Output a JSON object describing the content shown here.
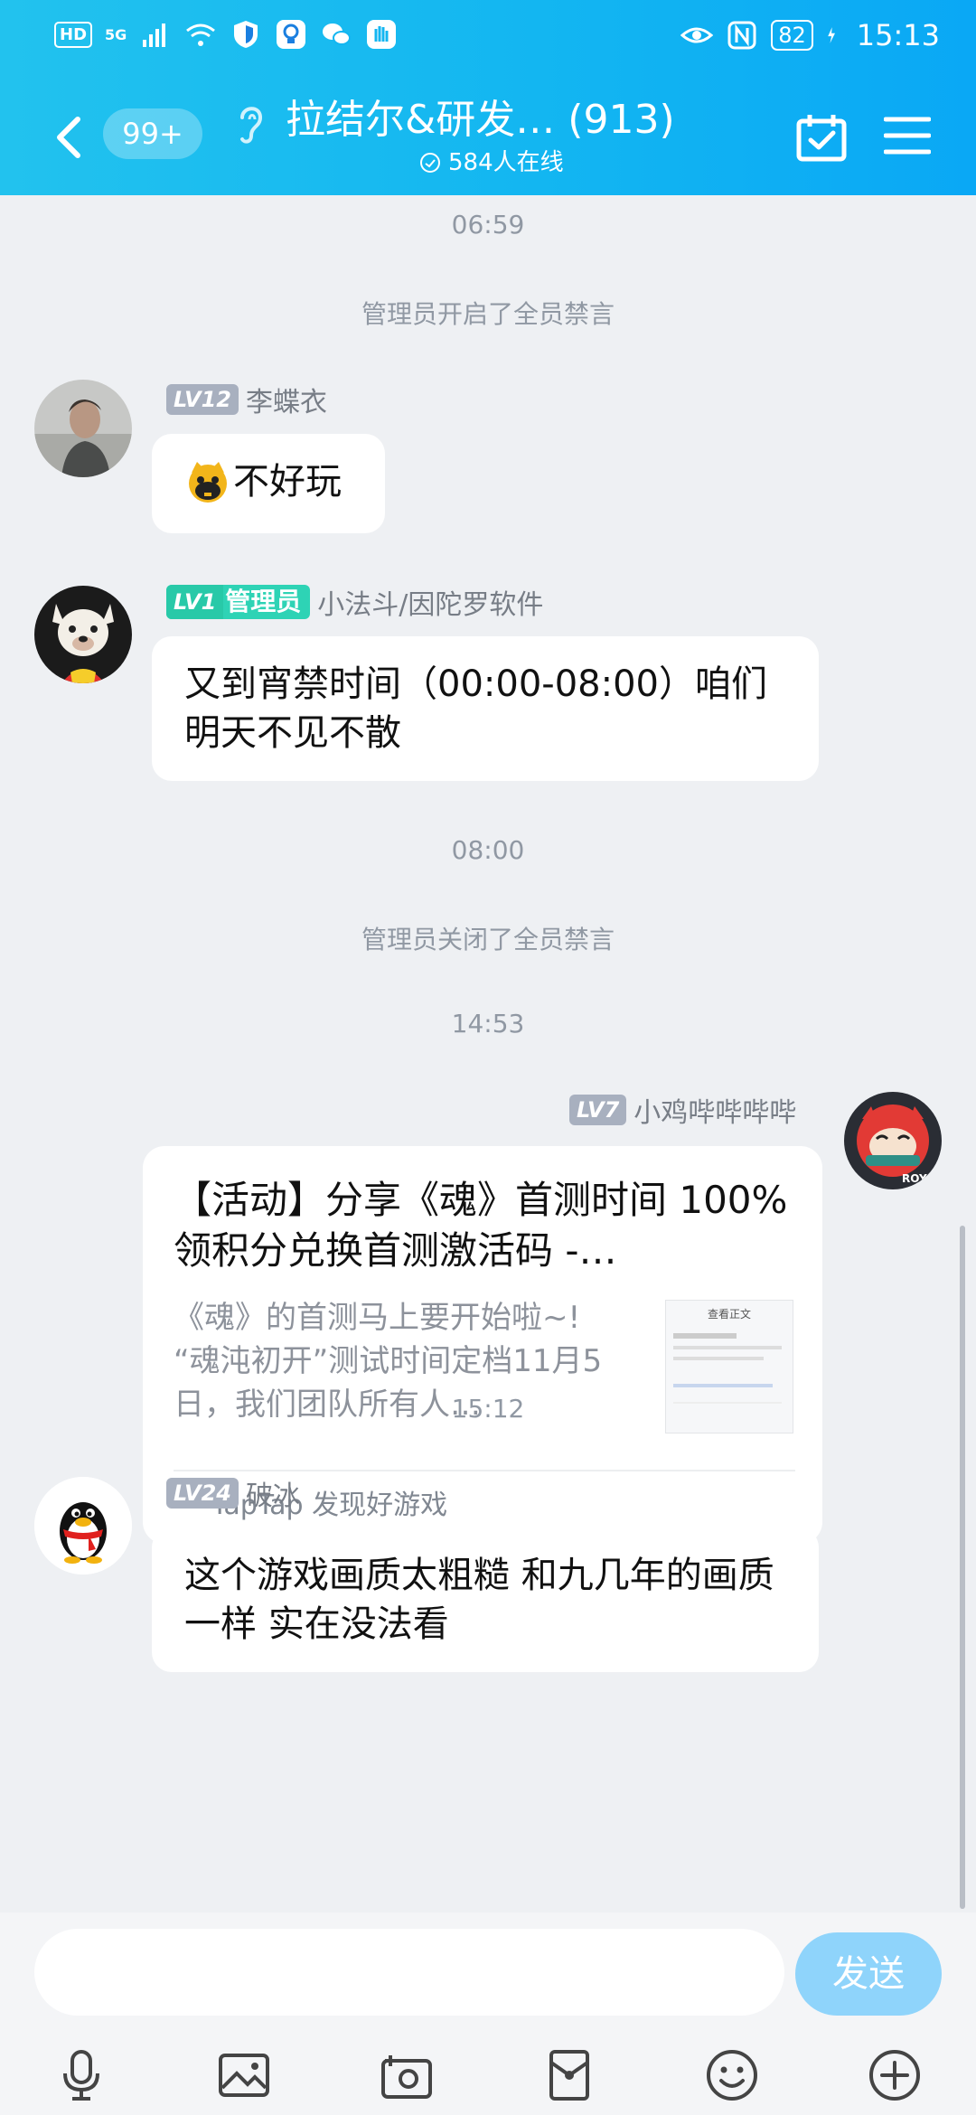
{
  "status_bar": {
    "hd": "HD",
    "network": "5G",
    "battery": "82",
    "time": "15:13"
  },
  "nav": {
    "unread_count": "99+",
    "title": "拉结尔&研发…  (913)",
    "online": "584人在线"
  },
  "messages": {
    "time_1": "06:59",
    "notice_1": "管理员开启了全员禁言",
    "msg1_lv": "LV12",
    "msg1_name": "李蝶衣",
    "msg1_text": "不好玩",
    "msg2_lv": "LV1",
    "msg2_role": "管理员",
    "msg2_name": "小法斗/因陀罗软件",
    "msg2_text": "又到宵禁时间（00:00-08:00）咱们明天不见不散",
    "time_2": "08:00",
    "notice_2": "管理员关闭了全员禁言",
    "time_3": "14:53",
    "msg3_lv": "LV7",
    "msg3_name": "小鸡哔哔哔哔",
    "card_title": "【活动】分享《魂》首测时间 100%领积分兑换首测激活码 -…",
    "card_desc": "《魂》的首测马上要开始啦~! “魂沌初开”测试时间定档11月5日，我们团队所有人…",
    "card_thumb_heading": "查看正文",
    "card_source": "TapTap 发现好游戏",
    "time_4": "15:12",
    "msg4_lv": "LV24",
    "msg4_name": "破冰",
    "msg4_text": "这个游戏画质太粗糙 和九几年的画质一样 实在没法看"
  },
  "input": {
    "placeholder": "",
    "send_label": "发送"
  },
  "colors": {
    "header_start": "#22c2ee",
    "header_end": "#0aa8f5",
    "background": "#eef0f3",
    "send_button": "#8fd4fb",
    "admin_badge": "#2ed3b5"
  },
  "icons": [
    "back-arrow-icon",
    "ear-icon",
    "check-circle-icon",
    "calendar-check-icon",
    "menu-icon",
    "mic-icon",
    "image-icon",
    "camera-icon",
    "red-packet-icon",
    "emoji-icon",
    "plus-icon"
  ]
}
